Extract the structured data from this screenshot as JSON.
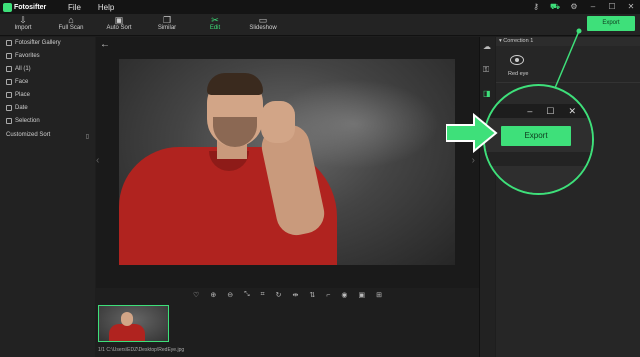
{
  "app": {
    "name": "Fotosifter"
  },
  "menu": {
    "file": "File",
    "help": "Help"
  },
  "toolbar": {
    "import": "Import",
    "full_scan": "Full Scan",
    "auto_sort": "Auto Sort",
    "similar": "Similar",
    "edit": "Edit",
    "slideshow": "Slideshow",
    "export": "Export"
  },
  "sidebar": {
    "items": [
      {
        "label": "Fotosifter Gallery",
        "icon": "gallery-icon"
      },
      {
        "label": "Favorites",
        "icon": "star-icon"
      },
      {
        "label": "All (1)",
        "icon": "grid-icon"
      },
      {
        "label": "Face",
        "icon": "face-icon"
      },
      {
        "label": "Place",
        "icon": "place-icon"
      },
      {
        "label": "Date",
        "icon": "calendar-icon"
      },
      {
        "label": "Selection",
        "icon": "thumb-icon"
      }
    ],
    "customized_sort": "Customized Sort"
  },
  "right_panel": {
    "section": "Correction 1",
    "tool_label": "Red eye"
  },
  "callout": {
    "export_label": "Export",
    "minimize": "–",
    "maximize": "☐",
    "close": "✕"
  },
  "filmstrip": {
    "path": "1/1  C:\\Users\\EDZ\\Desktop\\RedEye.jpg"
  },
  "colors": {
    "accent": "#3ee07a",
    "shirt": "#b0231f"
  }
}
